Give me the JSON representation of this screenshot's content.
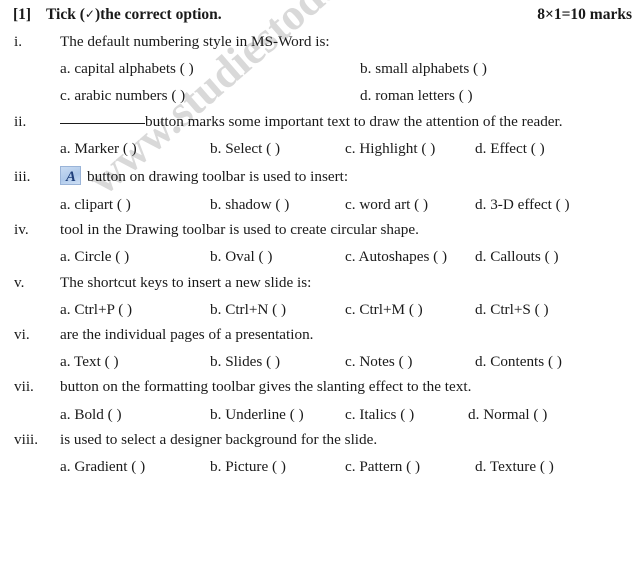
{
  "header": {
    "question_number": "[1]",
    "instruction_before_tick": "Tick (",
    "tick_symbol": "✓",
    "instruction_after_tick": ")the correct option.",
    "marks": "8×1=10 marks"
  },
  "watermark": {
    "text": "www.studiestoday.com",
    "color": "#d9d9d9"
  },
  "icons": {
    "wordart": {
      "name": "wordart-icon",
      "letter": "A",
      "background": "#aec9ea",
      "letter_color": "#1f3f7a"
    }
  },
  "questions": [
    {
      "numeral": "i.",
      "text": "The default numbering style in MS-Word is:",
      "layout": "two-column",
      "rows": [
        [
          "a. capital alphabets (  )",
          "b. small alphabets (  )"
        ],
        [
          "c. arabic numbers (  )",
          "d. roman letters (  )"
        ]
      ]
    },
    {
      "numeral": "ii.",
      "has_blank": true,
      "text": "button marks some important text to draw the attention of the  reader.",
      "layout": "four-column",
      "options": [
        "a. Marker (  )",
        "b. Select (  )",
        "c. Highlight (  )",
        "d. Effect (  )"
      ]
    },
    {
      "numeral": "iii.",
      "has_icon": "wordart",
      "text": "button on drawing toolbar is used to insert:",
      "layout": "four-column",
      "options": [
        "a. clipart (  )",
        "b. shadow (  )",
        "c. word art (  )",
        "d. 3-D effect (  )"
      ]
    },
    {
      "numeral": "iv.",
      "text": "tool in the Drawing toolbar is used to create circular shape.",
      "layout": "four-column",
      "options": [
        "a. Circle (  )",
        "b. Oval (  )",
        "c. Autoshapes (  )",
        "d. Callouts (  )"
      ]
    },
    {
      "numeral": "v.",
      "text": "The shortcut keys to insert a new slide is:",
      "layout": "four-column",
      "options": [
        "a. Ctrl+P (  )",
        "b. Ctrl+N (  )",
        "c. Ctrl+M (  )",
        "d. Ctrl+S (  )"
      ]
    },
    {
      "numeral": "vi.",
      "text": "are the individual pages of a presentation.",
      "layout": "four-column",
      "options": [
        "a. Text (  )",
        "b. Slides (  )",
        "c. Notes (  )",
        "d. Contents (  )"
      ]
    },
    {
      "numeral": "vii.",
      "text": "button on the formatting toolbar gives the slanting effect to the text.",
      "layout": "four-column",
      "options": [
        "a. Bold (  )",
        "b. Underline (  )",
        "c. Italics (  )",
        "d. Normal (  )"
      ]
    },
    {
      "numeral": "viii.",
      "text": "is used to select a designer background for the slide.",
      "layout": "four-column",
      "options": [
        "a. Gradient (  )",
        "b. Picture (  )",
        "c. Pattern (  )",
        "d. Texture (  )"
      ]
    }
  ]
}
